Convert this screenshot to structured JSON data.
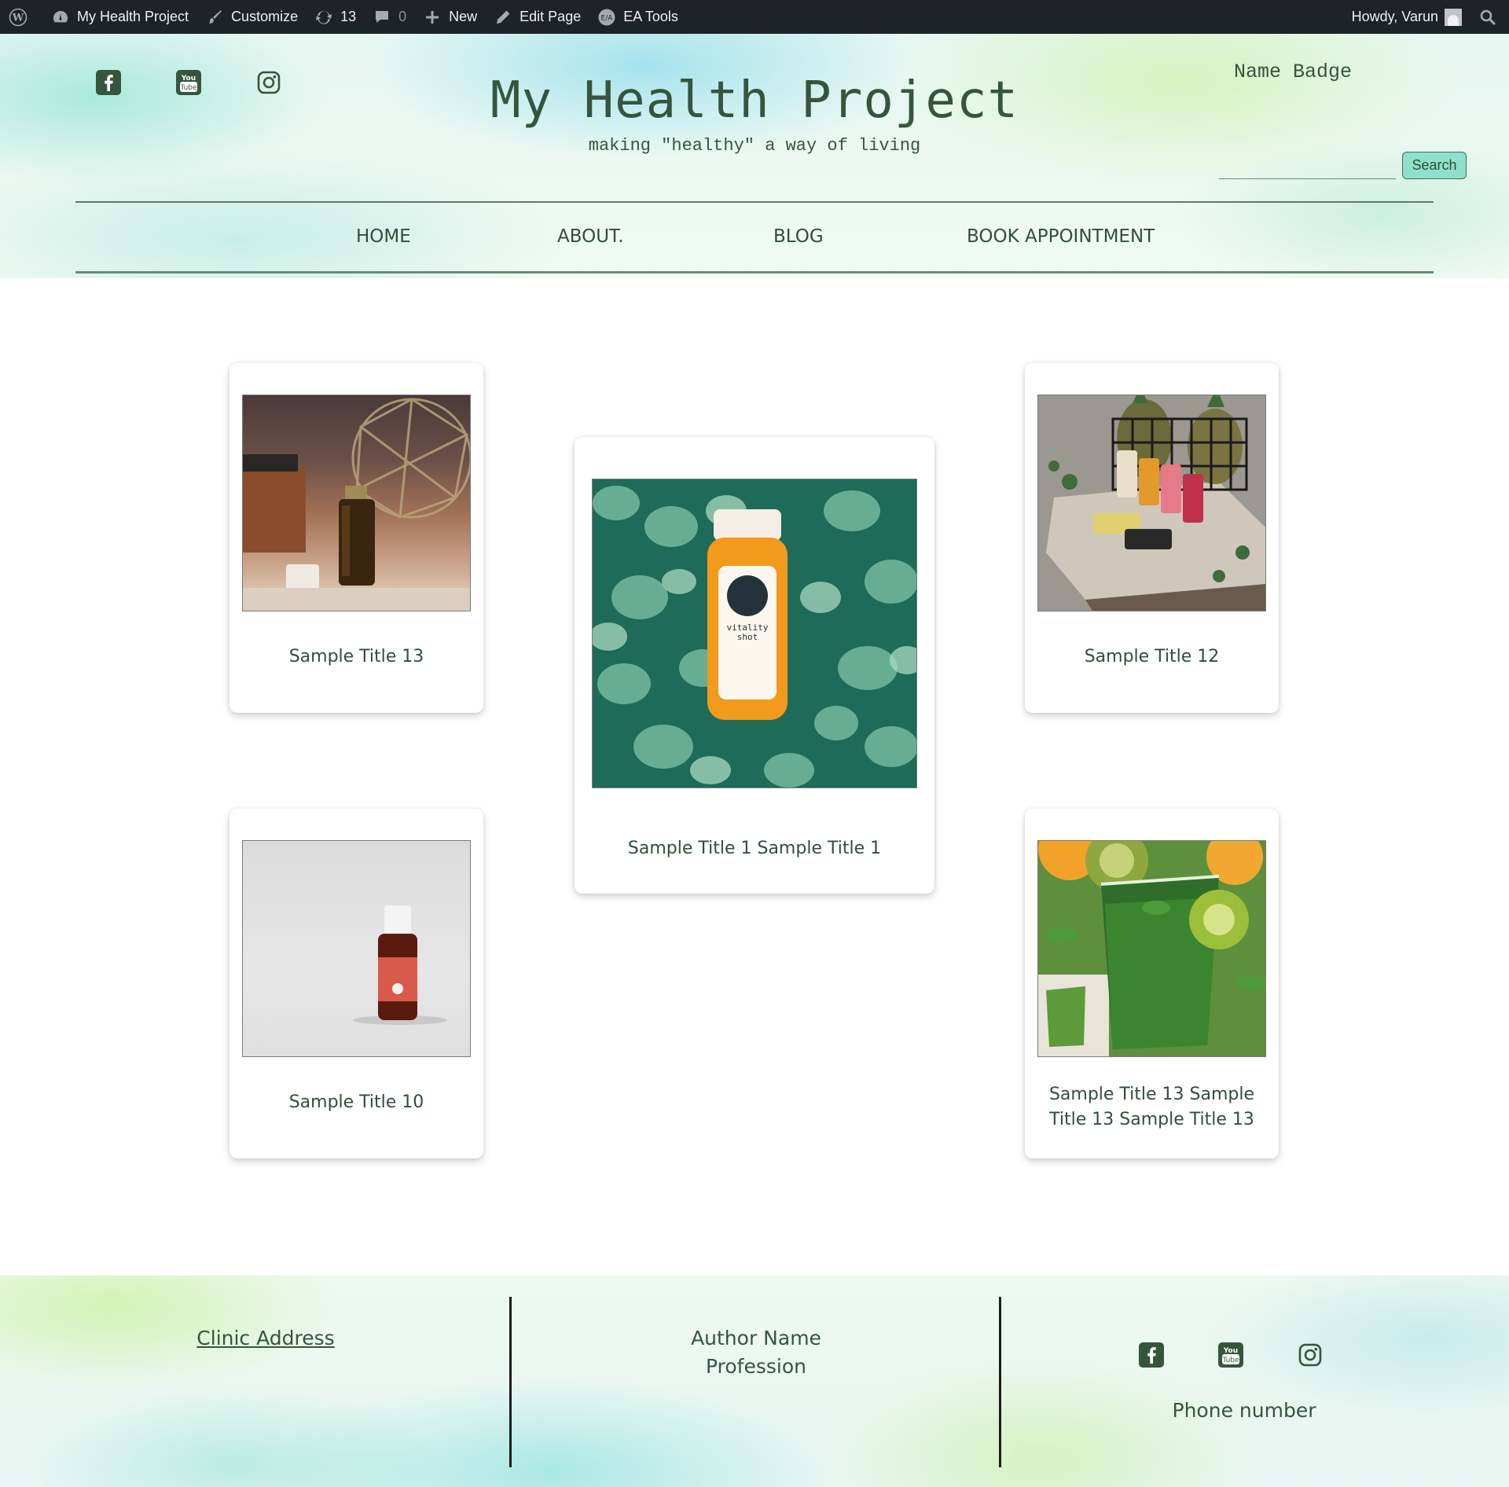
{
  "admin_bar": {
    "site_name": "My Health Project",
    "customize": "Customize",
    "updates_count": "13",
    "comments_count": "0",
    "new_label": "New",
    "edit_page": "Edit Page",
    "ea_tools": "EA Tools",
    "howdy": "Howdy, Varun"
  },
  "header": {
    "title": "My Health Project",
    "tagline": "making \"healthy\" a way of living",
    "name_badge": "Name Badge",
    "search_button": "Search",
    "search_value": "",
    "social_icons": [
      "facebook-icon",
      "youtube-icon",
      "instagram-icon"
    ]
  },
  "nav": {
    "items": [
      "HOME",
      "ABOUT.",
      "BLOG",
      "BOOK APPOINTMENT"
    ]
  },
  "cards": [
    {
      "title": "Sample Title 13",
      "image": "essential-oil-bottle-photo"
    },
    {
      "title": "Sample Title 1 Sample Title 1",
      "image": "juice-bottle-eucalyptus-photo"
    },
    {
      "title": "Sample Title 12",
      "image": "juice-bottles-pineapple-crate-photo"
    },
    {
      "title": "Sample Title 10",
      "image": "patchouli-oil-bottle-photo"
    },
    {
      "title": "Sample Title 13 Sample Title 13 Sample Title 13",
      "image": "green-smoothie-kiwi-photo"
    }
  ],
  "footer": {
    "clinic_address": "Clinic Address",
    "author_name": "Author Name",
    "profession": "Profession",
    "phone": "Phone number",
    "social_icons": [
      "facebook-icon",
      "youtube-icon",
      "instagram-icon"
    ]
  },
  "colors": {
    "admin_bar_bg": "#1d2327",
    "text_green": "#35553d",
    "search_button_bg": "#8fe0cc"
  }
}
